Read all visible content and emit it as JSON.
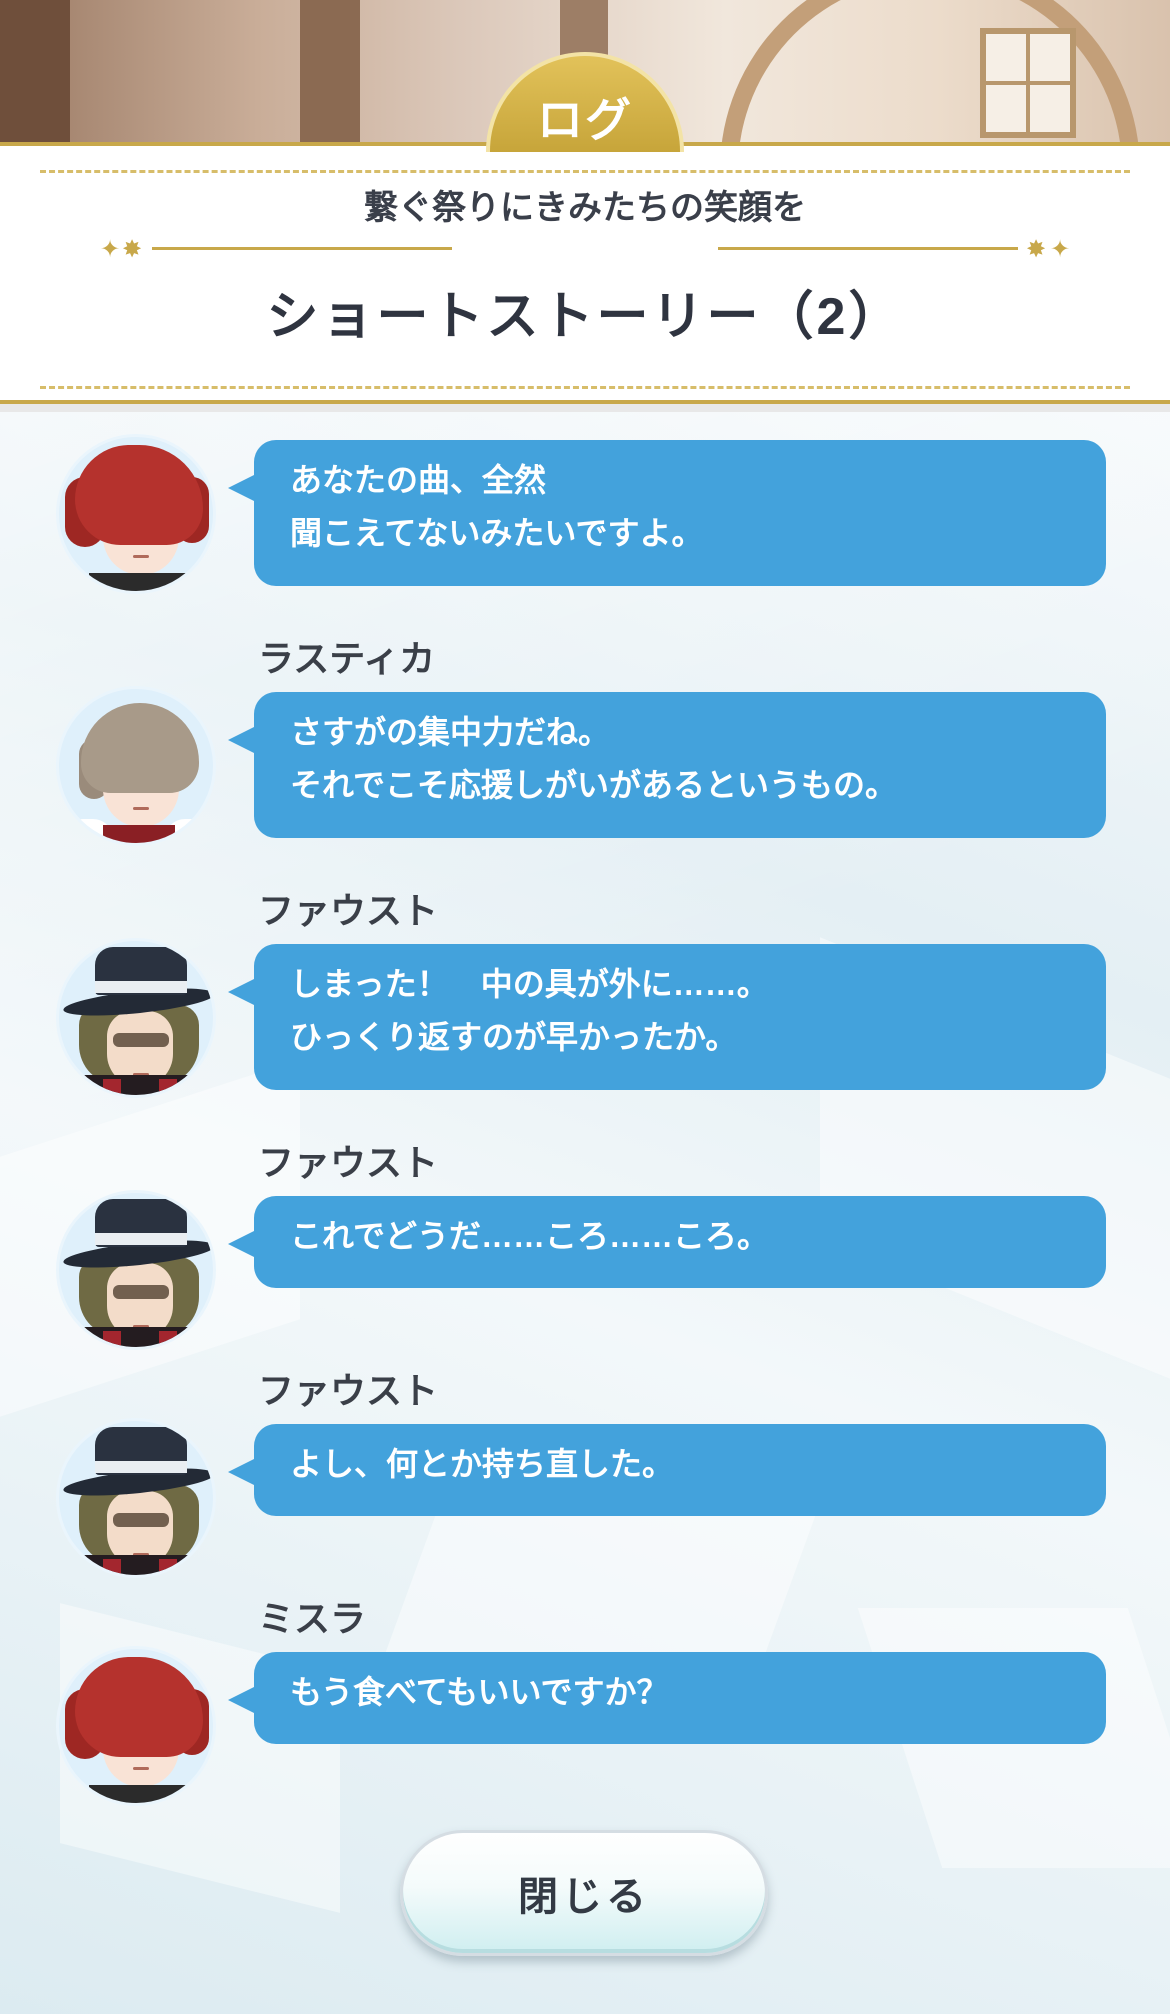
{
  "header": {
    "tab_label": "ログ",
    "subtitle": "繋ぐ祭りにきみたちの笑顔を",
    "title": "ショートストーリー（2）"
  },
  "log": [
    {
      "speaker": "",
      "character": "red-hair-character",
      "text": "あなたの曲、全然\n聞こえてないみたいですよ。"
    },
    {
      "speaker": "ラスティカ",
      "character": "ash-hair-character",
      "text": "さすがの集中力だね。\nそれでこそ応援しがいがあるというもの。"
    },
    {
      "speaker": "ファウスト",
      "character": "hat-character",
      "text": "しまった！　中の具が外に……。\nひっくり返すのが早かったか。"
    },
    {
      "speaker": "ファウスト",
      "character": "hat-character",
      "text": "これでどうだ……ころ……ころ。"
    },
    {
      "speaker": "ファウスト",
      "character": "hat-character",
      "text": "よし、何とか持ち直した。"
    },
    {
      "speaker": "ミスラ",
      "character": "red-hair-character",
      "text": "もう食べてもいいですか？"
    }
  ],
  "close_button": {
    "label": "閉じる"
  },
  "colors": {
    "accent_gold": "#c8a84a",
    "bubble_blue": "#43a2dc",
    "text_dark": "#2f3440"
  }
}
